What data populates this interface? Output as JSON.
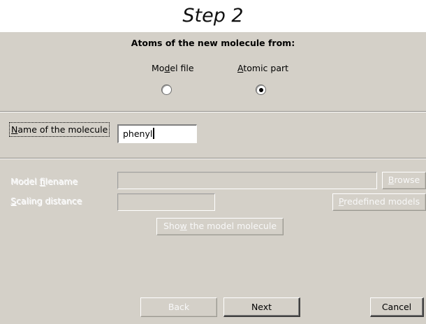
{
  "step_title": "Step 2",
  "source_section": {
    "heading": "Atoms of the new molecule from:",
    "options": [
      {
        "label_pre": "Mo",
        "label_u": "d",
        "label_post": "el file",
        "selected": false
      },
      {
        "label_pre": "",
        "label_u": "A",
        "label_post": "tomic part",
        "selected": true
      }
    ]
  },
  "name_field": {
    "label_pre": "",
    "label_u": "N",
    "label_post": "ame of the molecule",
    "value": "phenyl"
  },
  "model_section": {
    "filename_label_pre": "Model ",
    "filename_label_u": "f",
    "filename_label_post": "ilename",
    "filename_value": "",
    "browse_pre": "",
    "browse_u": "B",
    "browse_post": "rowse",
    "scaling_label_pre": "",
    "scaling_label_u": "S",
    "scaling_label_post": "caling distance",
    "scaling_value": "",
    "predefined_pre": "",
    "predefined_u": "P",
    "predefined_post": "redefined models",
    "show_pre": "Sho",
    "show_u": "w",
    "show_post": " the model molecule"
  },
  "footer": {
    "back_label": "Back",
    "next_label": "Next",
    "cancel_label": "Cancel"
  }
}
